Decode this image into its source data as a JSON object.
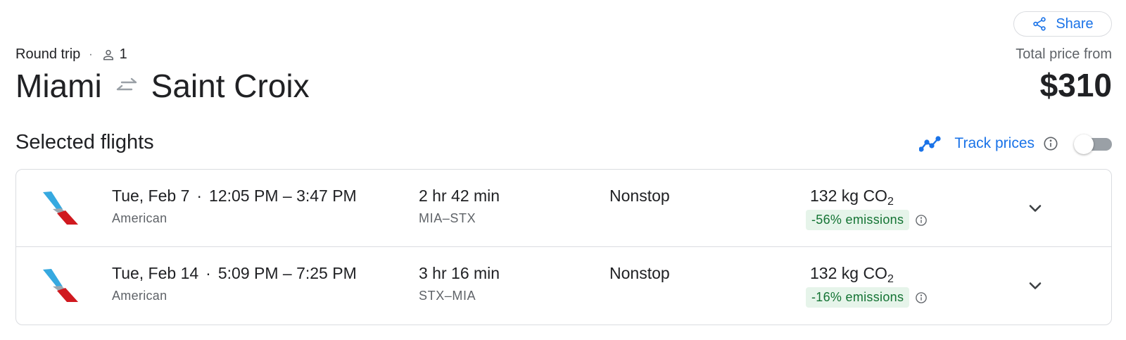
{
  "header": {
    "share_label": "Share",
    "trip_type": "Round trip",
    "separator": "·",
    "passenger_count": "1",
    "origin": "Miami",
    "destination": "Saint Croix",
    "price_label": "Total price from",
    "price": "$310"
  },
  "selected": {
    "title": "Selected flights",
    "track_label": "Track prices",
    "track_enabled": false
  },
  "flights": [
    {
      "date": "Tue, Feb 7",
      "times": "12:05 PM – 3:47 PM",
      "airline": "American",
      "duration": "2 hr 42 min",
      "route": "MIA–STX",
      "stops": "Nonstop",
      "co2_value": "132 kg CO",
      "co2_sub": "2",
      "emissions": "-56% emissions"
    },
    {
      "date": "Tue, Feb 14",
      "times": "5:09 PM – 7:25 PM",
      "airline": "American",
      "duration": "3 hr 16 min",
      "route": "STX–MIA",
      "stops": "Nonstop",
      "co2_value": "132 kg CO",
      "co2_sub": "2",
      "emissions": "-16% emissions"
    }
  ],
  "icons": {
    "share": "share-icon",
    "person": "person-icon",
    "swap": "swap-arrows-icon",
    "trend": "trend-line-icon",
    "info": "info-icon",
    "chevron": "chevron-down-icon",
    "airline_logo": "american-airlines-logo"
  },
  "colors": {
    "accent": "#1a73e8",
    "text": "#202124",
    "muted": "#5f6368",
    "emissions_bg": "#e6f4ea",
    "emissions_text": "#137333",
    "border": "#dadce0"
  }
}
